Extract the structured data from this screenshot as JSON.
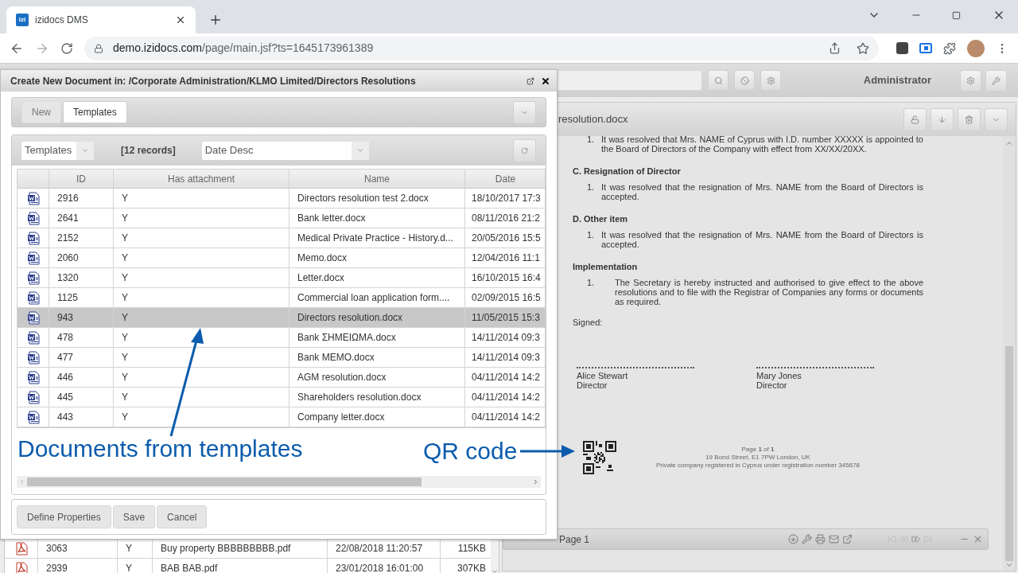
{
  "browser": {
    "favicon_text": "izi",
    "tab_title": "izidocs DMS",
    "url_host": "demo.izidocs.com",
    "url_path": "/page/main.jsf?ts=1645173961389"
  },
  "app_toolbar": {
    "user": "Administrator"
  },
  "dialog": {
    "title": "Create New Document in: /Corporate Administration/KLMO Limited/Directors Resolutions",
    "tabs": [
      {
        "label": "New",
        "selected": false
      },
      {
        "label": "Templates",
        "selected": true
      }
    ],
    "filter": "Templates",
    "records": "[12 records]",
    "sort": "Date Desc",
    "columns": [
      "ID",
      "Has attachment",
      "Name",
      "Date"
    ],
    "rows": [
      {
        "id": "2916",
        "has_attachment": "Y",
        "name": "Directors resolution test 2.docx",
        "date": "18/10/2017 17:3",
        "selected": false
      },
      {
        "id": "2641",
        "has_attachment": "Y",
        "name": "Bank letter.docx",
        "date": "08/11/2016 21:2",
        "selected": false
      },
      {
        "id": "2152",
        "has_attachment": "Y",
        "name": "Medical Private Practice - History.d...",
        "date": "20/05/2016 15:5",
        "selected": false
      },
      {
        "id": "2060",
        "has_attachment": "Y",
        "name": "Memo.docx",
        "date": "12/04/2016 11:1",
        "selected": false
      },
      {
        "id": "1320",
        "has_attachment": "Y",
        "name": "Letter.docx",
        "date": "16/10/2015 16:4",
        "selected": false
      },
      {
        "id": "1125",
        "has_attachment": "Y",
        "name": "Commercial loan application form....",
        "date": "02/09/2015 16:5",
        "selected": false
      },
      {
        "id": "943",
        "has_attachment": "Y",
        "name": "Directors resolution.docx",
        "date": "11/05/2015 15:3",
        "selected": true
      },
      {
        "id": "478",
        "has_attachment": "Y",
        "name": "Bank ΣΗΜΕΙΩΜΑ.docx",
        "date": "14/11/2014 09:3",
        "selected": false
      },
      {
        "id": "477",
        "has_attachment": "Y",
        "name": "Bank MEMO.docx",
        "date": "14/11/2014 09:3",
        "selected": false
      },
      {
        "id": "446",
        "has_attachment": "Y",
        "name": "AGM resolution.docx",
        "date": "04/11/2014 14:2",
        "selected": false
      },
      {
        "id": "445",
        "has_attachment": "Y",
        "name": "Shareholders resolution.docx",
        "date": "04/11/2014 14:2",
        "selected": false
      },
      {
        "id": "443",
        "has_attachment": "Y",
        "name": "Company letter.docx",
        "date": "04/11/2014 14:2",
        "selected": false
      }
    ],
    "buttons": [
      "Define Properties",
      "Save",
      "Cancel"
    ]
  },
  "background_rows": [
    {
      "id": "3063",
      "has_attachment": "Y",
      "name": "Buy property BBBBBBBBB.pdf",
      "date": "22/08/2018 11:20:57",
      "size": "115KB"
    },
    {
      "id": "2939",
      "has_attachment": "Y",
      "name": "BAB BAB.pdf",
      "date": "23/01/2018 16:01:00",
      "size": "307KB"
    }
  ],
  "viewer": {
    "title": "resolution.docx",
    "blocks": [
      {
        "kind": "item",
        "number": "1.",
        "text": "It was resolved that Mrs. NAME of Cyprus with I.D. number XXXXX is appointed to the Board of Directors of the Company with effect from XX/XX/20XX."
      },
      {
        "kind": "heading",
        "text": "C. Resignation of Director"
      },
      {
        "kind": "item",
        "number": "1.",
        "text": "It was resolved that the resignation of Mrs. NAME from the Board of Directors is accepted."
      },
      {
        "kind": "heading",
        "text": "D. Other item"
      },
      {
        "kind": "item",
        "number": "1.",
        "text": "It was resolved that the resignation of Mrs. NAME from the Board of Directors is accepted."
      },
      {
        "kind": "heading",
        "text": "Implementation"
      },
      {
        "kind": "item",
        "number": "1.",
        "text": "The Secretary is hereby instructed and authorised to give effect to the above resolutions and to file with the Registrar of Companies any forms or documents as required."
      },
      {
        "kind": "plain",
        "text": "Signed:"
      }
    ],
    "signatures": [
      {
        "name": "Alice Stewart",
        "role": "Director"
      },
      {
        "name": "Mary Jones",
        "role": "Director"
      }
    ],
    "footer": [
      "Page **1** of **1**",
      "19 Bond Street, E1 7PW London, UK",
      "Private company registered in Cyprus under registration number 345678"
    ],
    "page_label": "Page 1"
  },
  "annotations": [
    {
      "text": "Documents from templates"
    },
    {
      "text": "QR code"
    }
  ]
}
